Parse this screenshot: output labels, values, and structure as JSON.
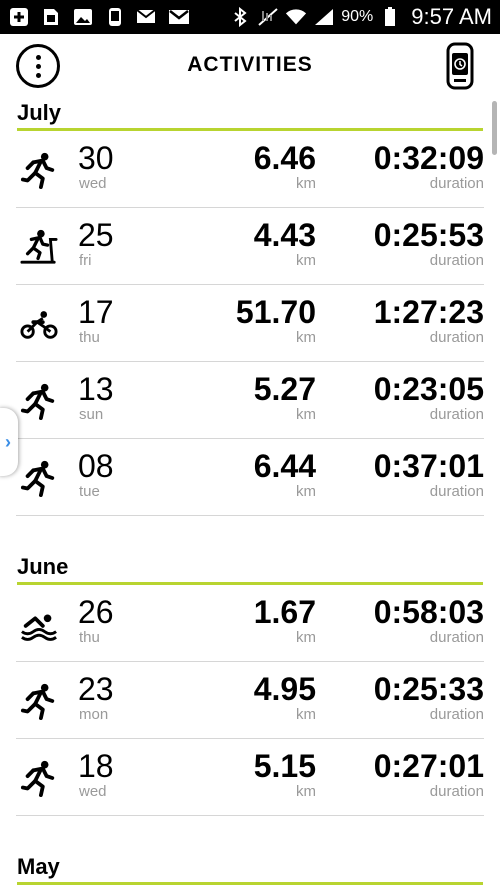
{
  "status_bar": {
    "battery": "90%",
    "time": "9:57 AM",
    "icons": [
      "add-icon",
      "sim-icon",
      "image-icon",
      "watch-icon",
      "email-icon",
      "gmail-icon",
      "bluetooth-icon",
      "data-off-icon",
      "wifi-icon",
      "signal-icon",
      "battery-icon"
    ]
  },
  "header": {
    "title": "ACTIVITIES",
    "menu_icon": "more-vert-icon",
    "device_icon": "watch-icon"
  },
  "colors": {
    "accent": "#b8d430",
    "muted": "#9a9a9a",
    "link": "#3a8ee6"
  },
  "months": [
    {
      "label": "July",
      "activities": [
        {
          "icon": "running-icon",
          "day": "30",
          "dow": "wed",
          "distance": "6.46",
          "unit": "km",
          "duration": "0:32:09",
          "duration_label": "duration"
        },
        {
          "icon": "treadmill-icon",
          "day": "25",
          "dow": "fri",
          "distance": "4.43",
          "unit": "km",
          "duration": "0:25:53",
          "duration_label": "duration"
        },
        {
          "icon": "cycling-icon",
          "day": "17",
          "dow": "thu",
          "distance": "51.70",
          "unit": "km",
          "duration": "1:27:23",
          "duration_label": "duration"
        },
        {
          "icon": "running-icon",
          "day": "13",
          "dow": "sun",
          "distance": "5.27",
          "unit": "km",
          "duration": "0:23:05",
          "duration_label": "duration"
        },
        {
          "icon": "running-icon",
          "day": "08",
          "dow": "tue",
          "distance": "6.44",
          "unit": "km",
          "duration": "0:37:01",
          "duration_label": "duration"
        }
      ]
    },
    {
      "label": "June",
      "activities": [
        {
          "icon": "swimming-icon",
          "day": "26",
          "dow": "thu",
          "distance": "1.67",
          "unit": "km",
          "duration": "0:58:03",
          "duration_label": "duration"
        },
        {
          "icon": "running-icon",
          "day": "23",
          "dow": "mon",
          "distance": "4.95",
          "unit": "km",
          "duration": "0:25:33",
          "duration_label": "duration"
        },
        {
          "icon": "running-icon",
          "day": "18",
          "dow": "wed",
          "distance": "5.15",
          "unit": "km",
          "duration": "0:27:01",
          "duration_label": "duration"
        }
      ]
    },
    {
      "label": "May",
      "activities": []
    }
  ]
}
